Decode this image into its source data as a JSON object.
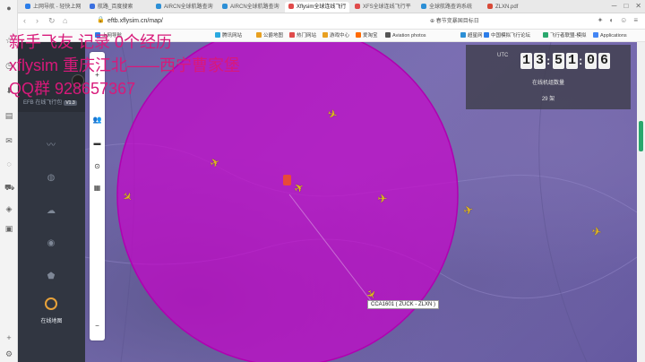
{
  "browser": {
    "tabs": [
      {
        "label": "上网导航 - 轻快上网",
        "fav": "#2b7de9"
      },
      {
        "label": "航路_百度搜索",
        "fav": "#3a6fe0"
      },
      {
        "label": "AIRCN全球航路查询",
        "fav": "#2c8fd6"
      },
      {
        "label": "AIRCN全球航路查询",
        "fav": "#2c8fd6"
      },
      {
        "label": "Xflysim全球连线飞行",
        "fav": "#e04b4b"
      },
      {
        "label": "XFS全球连线飞行平",
        "fav": "#e04b4b"
      },
      {
        "label": "全球航路查询系统",
        "fav": "#2c8fd6"
      },
      {
        "label": "ZLXN.pdf",
        "fav": "#d84a38"
      }
    ],
    "url": "eftb.xflysim.cn/map/",
    "search_hint": "春节变暴国目标日",
    "bookmarks": [
      {
        "label": "上网导航",
        "fav": "#2b7de9"
      },
      {
        "label": "腾讯网站",
        "fav": "#2aa9e0"
      },
      {
        "label": "公爵地图",
        "fav": "#e8a020"
      },
      {
        "label": "热门网站",
        "fav": "#e04b4b"
      },
      {
        "label": "游戏中心",
        "fav": "#e8a020"
      },
      {
        "label": "爱淘宝",
        "fav": "#ff6a00"
      },
      {
        "label": "Aviation photos",
        "fav": "#555555"
      },
      {
        "label": "超星网",
        "fav": "#2c8fd6"
      },
      {
        "label": "中国模拟飞行论坛",
        "fav": "#2b7de9"
      },
      {
        "label": "飞行者联盟-模拟",
        "fav": "#2aa86d"
      },
      {
        "label": "Applications",
        "fav": "#4285f4"
      }
    ]
  },
  "app": {
    "name": "EFB 在线飞行包",
    "version": "V1.3",
    "active_nav_label": "在线地图"
  },
  "utc": {
    "label": "UTC",
    "digits": [
      "1",
      "3",
      "5",
      "1",
      "0",
      "6"
    ],
    "online_label": "在线机组数量",
    "online_count": "29 架"
  },
  "overlay": {
    "line1": "新手飞友 记录 0个经历",
    "line2": "xflysim 重庆江北——西宁曹家堡",
    "line3": "QQ群 928657367"
  },
  "map": {
    "callsign": "CCA1601 ( ZUCK - ZLXN )",
    "circle_color": "#d000d0"
  }
}
